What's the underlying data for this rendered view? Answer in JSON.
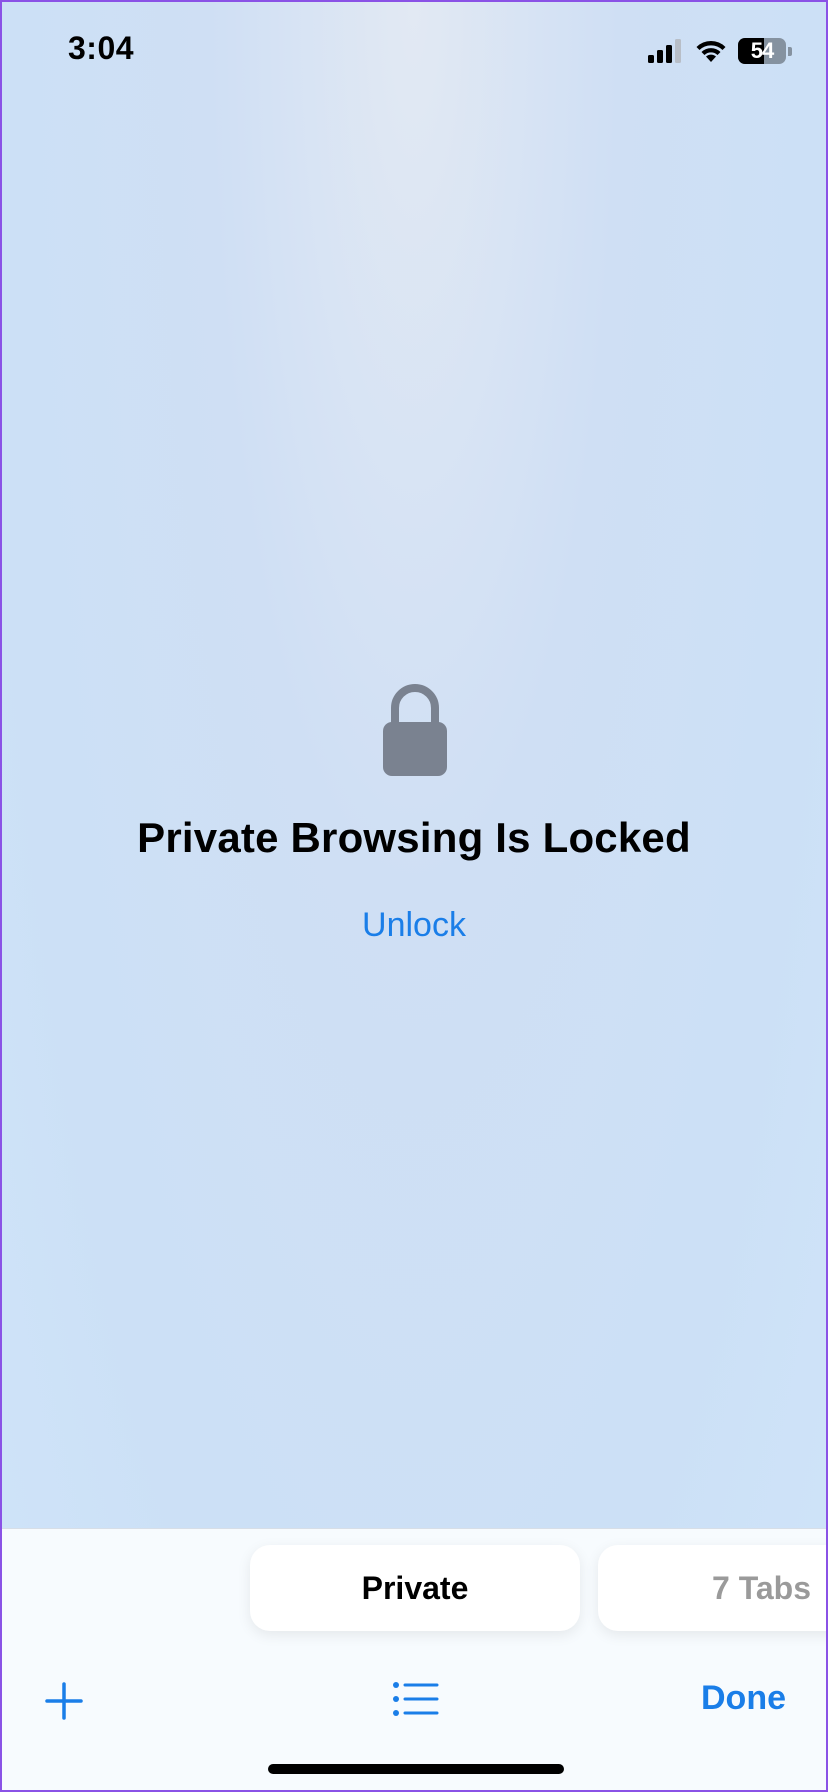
{
  "status_bar": {
    "time": "3:04",
    "battery_level": "54",
    "icons": [
      "cellular-signal-icon",
      "wifi-icon",
      "battery-icon"
    ]
  },
  "lock_screen": {
    "icon": "lock-icon",
    "title": "Private Browsing Is Locked",
    "unlock_label": "Unlock"
  },
  "toolbar": {
    "groups": [
      {
        "label": "Private"
      },
      {
        "label": "7 Tabs"
      }
    ],
    "add_icon": "plus-icon",
    "list_icon": "list-icon",
    "done_label": "Done"
  },
  "colors": {
    "accent": "#1a7ee8",
    "lock_gray": "#7a8290",
    "inactive_text": "#9a9a9a"
  }
}
